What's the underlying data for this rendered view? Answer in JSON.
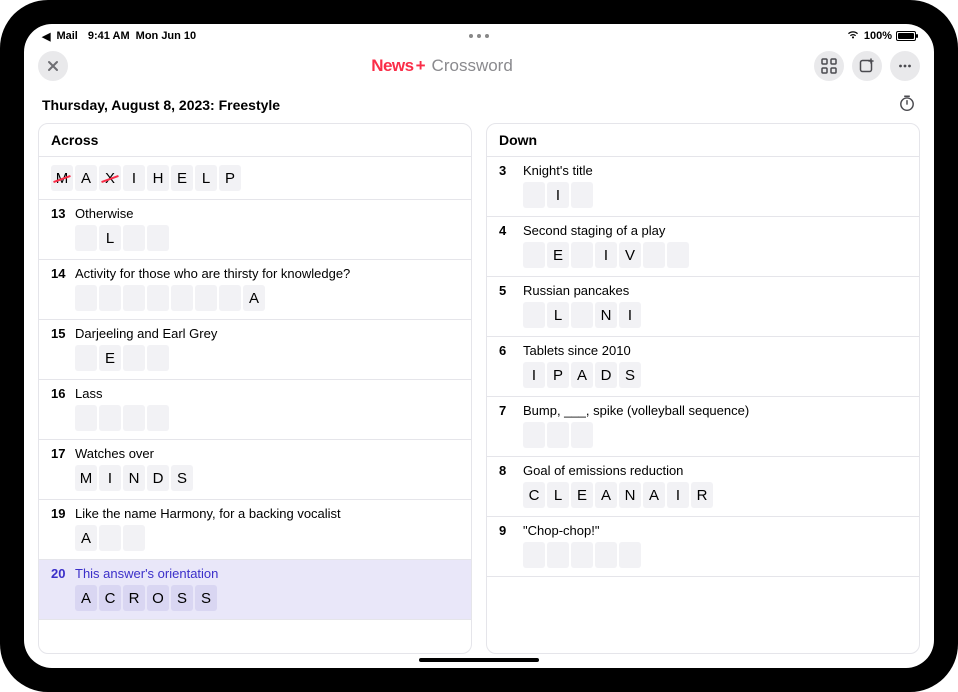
{
  "statusbar": {
    "back_app": "Mail",
    "time": "9:41 AM",
    "date": "Mon Jun 10",
    "battery_pct": "100%"
  },
  "navbar": {
    "brand": "News",
    "plus": "+",
    "subtitle": "Crossword"
  },
  "page_title": "Thursday, August 8, 2023: Freestyle",
  "across": {
    "header": "Across",
    "clues": [
      {
        "num": "",
        "text": "",
        "cells": [
          "M",
          "A",
          "X",
          "I",
          "H",
          "E",
          "L",
          "P"
        ],
        "errors": [
          0,
          2
        ],
        "no_head": true
      },
      {
        "num": "13",
        "text": "Otherwise",
        "cells": [
          "",
          "L",
          "",
          ""
        ]
      },
      {
        "num": "14",
        "text": "Activity for those who are thirsty for knowledge?",
        "cells": [
          "",
          "",
          "",
          "",
          "",
          "",
          "",
          "A"
        ]
      },
      {
        "num": "15",
        "text": "Darjeeling and Earl Grey",
        "cells": [
          "",
          "E",
          "",
          ""
        ]
      },
      {
        "num": "16",
        "text": "Lass",
        "cells": [
          "",
          "",
          "",
          ""
        ]
      },
      {
        "num": "17",
        "text": "Watches over",
        "cells": [
          "M",
          "I",
          "N",
          "D",
          "S"
        ]
      },
      {
        "num": "19",
        "text": "Like the name Harmony, for a backing vocalist",
        "cells": [
          "A",
          "",
          ""
        ]
      },
      {
        "num": "20",
        "text": "This answer's orientation",
        "cells": [
          "A",
          "C",
          "R",
          "O",
          "S",
          "S"
        ],
        "selected": true
      }
    ]
  },
  "down": {
    "header": "Down",
    "clues": [
      {
        "num": "3",
        "text": "Knight's title",
        "cells": [
          "",
          "I",
          ""
        ]
      },
      {
        "num": "4",
        "text": "Second staging of a play",
        "cells": [
          "",
          "E",
          "",
          "I",
          "V",
          "",
          ""
        ]
      },
      {
        "num": "5",
        "text": "Russian pancakes",
        "cells": [
          "",
          "L",
          "",
          "N",
          "I"
        ]
      },
      {
        "num": "6",
        "text": "Tablets since 2010",
        "cells": [
          "I",
          "P",
          "A",
          "D",
          "S"
        ]
      },
      {
        "num": "7",
        "text": "Bump, ___, spike (volleyball sequence)",
        "cells": [
          "",
          "",
          ""
        ]
      },
      {
        "num": "8",
        "text": "Goal of emissions reduction",
        "cells": [
          "C",
          "L",
          "E",
          "A",
          "N",
          "A",
          "I",
          "R"
        ]
      },
      {
        "num": "9",
        "text": "\"Chop-chop!\"",
        "cells": [
          "",
          "",
          "",
          "",
          ""
        ]
      }
    ]
  }
}
